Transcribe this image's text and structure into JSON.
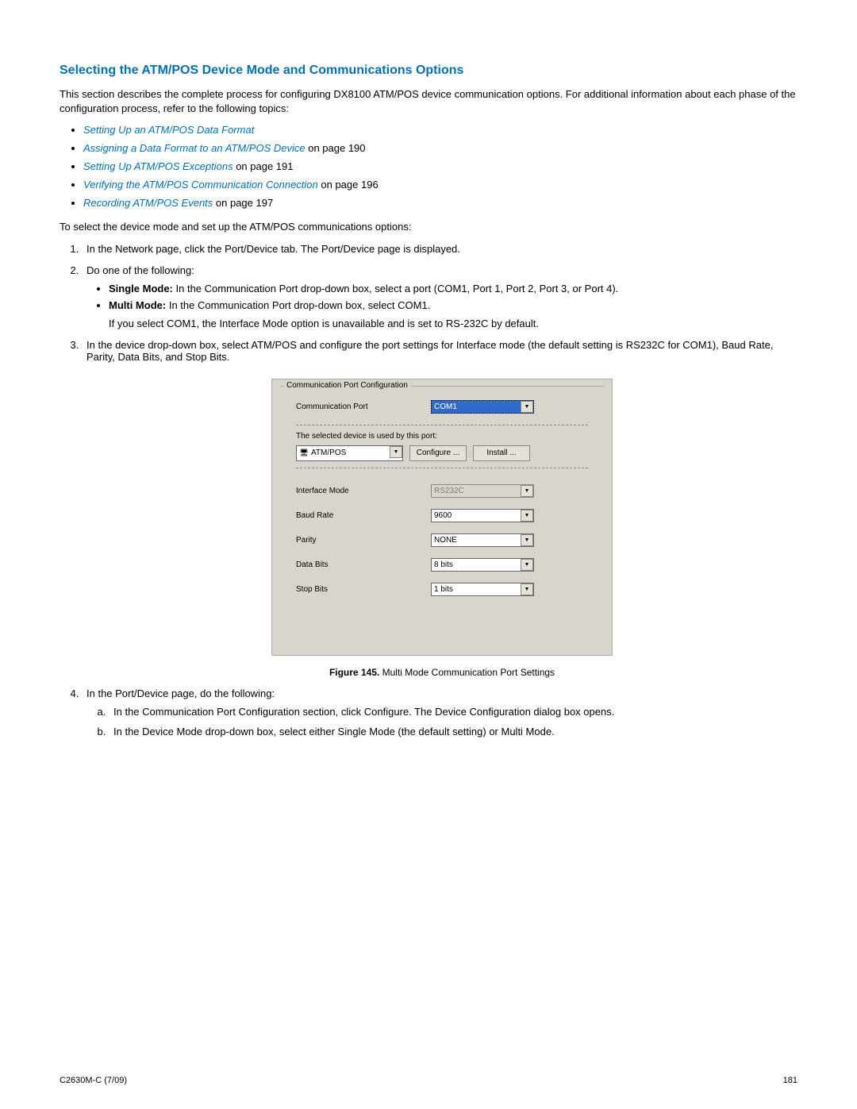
{
  "heading": "Selecting the ATM/POS Device Mode and Communications Options",
  "intro": "This section describes the complete process for configuring DX8100 ATM/POS device communication options. For additional information about each phase of the configuration process, refer to the following topics:",
  "topics": [
    {
      "link": "Setting Up an ATM/POS Data Format",
      "suffix": ""
    },
    {
      "link": "Assigning a Data Format to an ATM/POS Device",
      "suffix": " on page 190"
    },
    {
      "link": "Setting Up ATM/POS Exceptions",
      "suffix": " on page 191"
    },
    {
      "link": "Verifying the ATM/POS Communication Connection",
      "suffix": " on page 196"
    },
    {
      "link": "Recording ATM/POS Events",
      "suffix": " on page 197"
    }
  ],
  "lead2": "To select the device mode and set up the ATM/POS communications options:",
  "step1": "In the Network page, click the Port/Device tab. The Port/Device page is displayed.",
  "step2": "Do one of the following:",
  "step2a_label": "Single Mode:",
  "step2a_text": " In the Communication Port drop-down box, select a port (COM1, Port 1, Port 2, Port 3, or Port 4).",
  "step2b_label": "Multi Mode:",
  "step2b_text": " In the Communication Port drop-down box, select COM1.",
  "step2_note": "If you select COM1, the Interface Mode option is unavailable and is set to RS-232C by default.",
  "step3": "In the device drop-down box, select ATM/POS and configure the port settings for Interface mode (the default setting is RS232C for COM1), Baud Rate, Parity, Data Bits, and Stop Bits.",
  "panel": {
    "group_title": "Communication Port Configuration",
    "comm_port_label": "Communication Port",
    "comm_port_value": "COM1",
    "used_by": "The selected device is used by this port:",
    "device_value": "ATM/POS",
    "configure_btn": "Configure ...",
    "install_btn": "Install ...",
    "rows": [
      {
        "label": "Interface Mode",
        "value": "RS232C",
        "disabled": true
      },
      {
        "label": "Baud Rate",
        "value": "9600",
        "disabled": false
      },
      {
        "label": "Parity",
        "value": "NONE",
        "disabled": false
      },
      {
        "label": "Data Bits",
        "value": "8 bits",
        "disabled": false
      },
      {
        "label": "Stop Bits",
        "value": "1 bits",
        "disabled": false
      }
    ]
  },
  "caption_bold": "Figure 145.",
  "caption_text": "  Multi Mode Communication Port Settings",
  "step4": "In the Port/Device page, do the following:",
  "step4a": "In the Communication Port Configuration section, click Configure. The Device Configuration dialog box opens.",
  "step4b": "In the Device Mode drop-down box, select either Single Mode (the default setting) or Multi Mode.",
  "footer_left": "C2630M-C (7/09)",
  "footer_right": "181"
}
